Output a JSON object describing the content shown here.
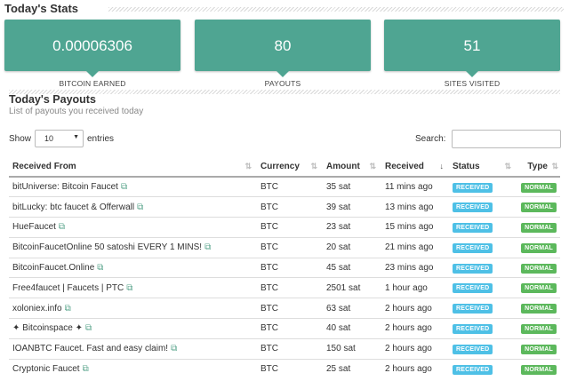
{
  "stats_section": {
    "title": "Today's Stats"
  },
  "stats": [
    {
      "value": "0.00006306",
      "label": "BITCOIN EARNED"
    },
    {
      "value": "80",
      "label": "PAYOUTS"
    },
    {
      "value": "51",
      "label": "SITES VISITED"
    }
  ],
  "payouts_section": {
    "title": "Today's Payouts",
    "subtitle": "List of payouts you received today"
  },
  "controls": {
    "show_label": "Show",
    "entries_value": "10",
    "entries_label": "entries",
    "search_label": "Search:",
    "search_value": ""
  },
  "table": {
    "columns": [
      "Received From",
      "Currency",
      "Amount",
      "Received",
      "Status",
      "Type"
    ],
    "rows": [
      [
        "bitUniverse: Bitcoin Faucet",
        "BTC",
        "35 sat",
        "11 mins ago",
        "RECEIVED",
        "NORMAL"
      ],
      [
        "bitLucky: btc faucet & Offerwall",
        "BTC",
        "39 sat",
        "13 mins ago",
        "RECEIVED",
        "NORMAL"
      ],
      [
        "HueFaucet",
        "BTC",
        "23 sat",
        "15 mins ago",
        "RECEIVED",
        "NORMAL"
      ],
      [
        "BitcoinFaucetOnline 50 satoshi EVERY 1 MINS!",
        "BTC",
        "20 sat",
        "21 mins ago",
        "RECEIVED",
        "NORMAL"
      ],
      [
        "BitcoinFaucet.Online",
        "BTC",
        "45 sat",
        "23 mins ago",
        "RECEIVED",
        "NORMAL"
      ],
      [
        "Free4faucet | Faucets | PTC",
        "BTC",
        "2501 sat",
        "1 hour ago",
        "RECEIVED",
        "NORMAL"
      ],
      [
        "xoloniex.info",
        "BTC",
        "63 sat",
        "2 hours ago",
        "RECEIVED",
        "NORMAL"
      ],
      [
        "✦ Bitcoinspace ✦",
        "BTC",
        "40 sat",
        "2 hours ago",
        "RECEIVED",
        "NORMAL"
      ],
      [
        "IOANBTC Faucet. Fast and easy claim!",
        "BTC",
        "150 sat",
        "2 hours ago",
        "RECEIVED",
        "NORMAL"
      ],
      [
        "Cryptonic Faucet",
        "BTC",
        "25 sat",
        "2 hours ago",
        "RECEIVED",
        "NORMAL"
      ]
    ]
  },
  "colors": {
    "card": "#4fa592",
    "received_badge": "#4ec0e6",
    "normal_badge": "#5cb85c",
    "link_icon": "#5aa58c"
  },
  "icons": {
    "external_link": "external-link-icon",
    "sort": "sort-icon",
    "dropdown": "chevron-down-icon"
  }
}
